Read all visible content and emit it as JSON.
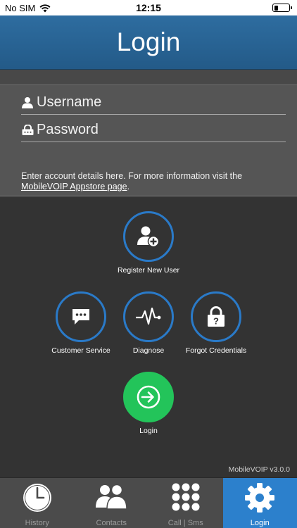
{
  "status_bar": {
    "carrier": "No SIM",
    "time": "12:15",
    "battery_level": 0.25
  },
  "header": {
    "title": "Login"
  },
  "form": {
    "username_placeholder": "Username",
    "password_placeholder": "Password",
    "info_text": "Enter account details here. For more information visit the ",
    "info_link": "MobileVOIP Appstore page",
    "info_suffix": "."
  },
  "actions": {
    "register": "Register New User",
    "customer_service": "Customer Service",
    "diagnose": "Diagnose",
    "forgot": "Forgot Credentials",
    "login": "Login"
  },
  "version": "MobileVOIP v3.0.0",
  "tabs": [
    {
      "label": "History",
      "icon": "clock-icon"
    },
    {
      "label": "Contacts",
      "icon": "contacts-icon"
    },
    {
      "label": "Call | Sms",
      "icon": "keypad-icon"
    },
    {
      "label": "Login",
      "icon": "gear-icon"
    }
  ],
  "colors": {
    "header": "#2a6699",
    "ring": "#2a7ac8",
    "login_button": "#23c45a",
    "active_tab": "#2c80cc"
  }
}
